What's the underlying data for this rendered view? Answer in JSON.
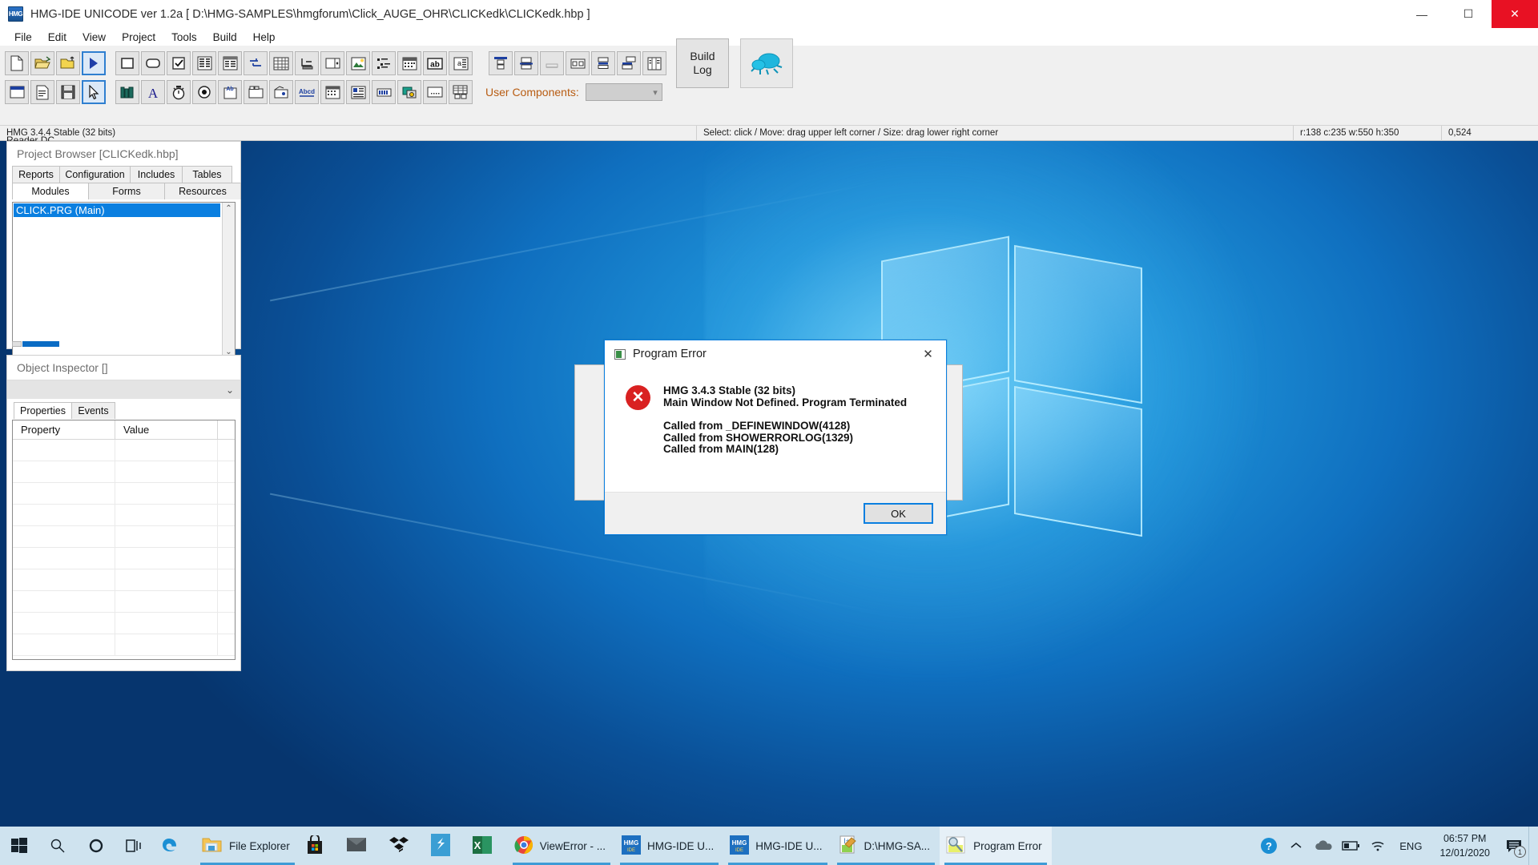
{
  "window": {
    "app_icon": "hmg-app-icon",
    "title": "HMG-IDE  UNICODE  ver 1.2a  [ D:\\HMG-SAMPLES\\hmgforum\\Click_AUGE_OHR\\CLICKedk\\CLICKedk.hbp ]",
    "minimize": "—",
    "maximize": "☐",
    "close": "✕"
  },
  "menu": {
    "items": [
      "File",
      "Edit",
      "View",
      "Project",
      "Tools",
      "Build",
      "Help"
    ]
  },
  "toolbar": {
    "row1": [
      {
        "name": "new-file-icon",
        "sel": false
      },
      {
        "name": "open-folder-icon",
        "sel": false
      },
      {
        "name": "save-folder-icon",
        "sel": false
      },
      {
        "name": "run-icon",
        "sel": true
      },
      {
        "name": "button-control-icon",
        "sel": false
      },
      {
        "name": "rounded-button-icon",
        "sel": false
      },
      {
        "name": "checkbox-control-icon",
        "sel": false
      },
      {
        "name": "listbox-control-icon",
        "sel": false
      },
      {
        "name": "grid-control-icon",
        "sel": false
      },
      {
        "name": "splitter-icon",
        "sel": false
      },
      {
        "name": "table-control-icon",
        "sel": false
      },
      {
        "name": "tree-control-icon",
        "sel": false
      },
      {
        "name": "spinner-control-icon",
        "sel": false
      },
      {
        "name": "image-control-icon",
        "sel": false
      },
      {
        "name": "treeview-icon",
        "sel": false
      },
      {
        "name": "month-calendar-icon",
        "sel": false
      },
      {
        "name": "label-ab-icon",
        "sel": false
      },
      {
        "name": "richtext-icon",
        "sel": false
      }
    ],
    "row1b": [
      {
        "name": "align-top-icon"
      },
      {
        "name": "align-middle-icon"
      },
      {
        "name": "align-bottom-icon"
      },
      {
        "name": "align-left-icon"
      },
      {
        "name": "align-center-icon"
      },
      {
        "name": "align-right-icon"
      },
      {
        "name": "distribute-icon"
      }
    ],
    "row2": [
      {
        "name": "window-icon",
        "sel": false
      },
      {
        "name": "document-icon",
        "sel": false
      },
      {
        "name": "save-disk-icon",
        "sel": false
      },
      {
        "name": "pointer-select-icon",
        "sel": true
      },
      {
        "name": "library-icon",
        "sel": false
      },
      {
        "name": "font-a-icon",
        "sel": false
      },
      {
        "name": "timer-icon",
        "sel": false
      },
      {
        "name": "radio-control-icon",
        "sel": false
      },
      {
        "name": "ab-frame-icon",
        "sel": false
      },
      {
        "name": "tab-control-icon",
        "sel": false
      },
      {
        "name": "player-control-icon",
        "sel": false
      },
      {
        "name": "abcd-link-icon",
        "sel": false
      },
      {
        "name": "date-picker-icon",
        "sel": false
      },
      {
        "name": "list-detail-icon",
        "sel": false
      },
      {
        "name": "progressbar-icon",
        "sel": false
      },
      {
        "name": "ole-control-icon",
        "sel": false
      },
      {
        "name": "panel-dotted-icon",
        "sel": false
      },
      {
        "name": "database-grid-icon",
        "sel": false
      }
    ],
    "user_components_label": "User Components:",
    "user_components_value": "",
    "build_log_line1": "Build",
    "build_log_line2": "Log",
    "debug_icon": "bug-icon"
  },
  "statusbar": {
    "version": "HMG 3.4.4 Stable (32 bits)",
    "hint": "Select: click / Move: drag upper left corner / Size: drag lower right corner",
    "geometry": "r:138 c:235 w:550 h:350",
    "coords": "0,524"
  },
  "desktop": {
    "peek_label": "Reader DC"
  },
  "browser": {
    "title": "Project Browser [CLICKedk.hbp]",
    "tabs_row1": [
      "Reports",
      "Configuration",
      "Includes",
      "Tables"
    ],
    "tabs_row2": [
      "Modules",
      "Forms",
      "Resources"
    ],
    "active_tab": "Modules",
    "items": [
      "CLICK.PRG (Main)"
    ],
    "scroll_up": "⌃",
    "scroll_down": "⌄"
  },
  "inspector": {
    "title": "Object Inspector []",
    "combo_value": "",
    "combo_caret": "⌄",
    "tabs": [
      "Properties",
      "Events"
    ],
    "active_tab": "Properties",
    "columns": [
      "Property",
      "Value",
      ""
    ],
    "rows": []
  },
  "dialog": {
    "icon": "program-window-icon",
    "title": "Program Error",
    "close": "✕",
    "error_icon": "error-cross-icon",
    "lines": [
      "HMG 3.4.3 Stable (32 bits)",
      "Main Window Not Defined. Program Terminated"
    ],
    "stack": [
      "Called from _DEFINEWINDOW(4128)",
      "Called from SHOWERRORLOG(1329)",
      "Called from MAIN(128)"
    ],
    "ok_label": "OK"
  },
  "taskbar": {
    "start": "windows-start-icon",
    "search": "search-icon",
    "cortana": "cortana-icon",
    "taskview": "task-view-icon",
    "pinned": [
      {
        "name": "edge-icon",
        "label": ""
      },
      {
        "name": "file-explorer-icon",
        "label": "File Explorer"
      },
      {
        "name": "microsoft-store-icon",
        "label": ""
      },
      {
        "name": "mail-icon",
        "label": ""
      },
      {
        "name": "dropbox-icon",
        "label": ""
      },
      {
        "name": "sublime-text-icon",
        "label": ""
      },
      {
        "name": "excel-icon",
        "label": ""
      }
    ],
    "tasks": [
      {
        "name": "chrome-icon",
        "label": "ViewError - ..."
      },
      {
        "name": "hmg-ide-icon",
        "label": "HMG-IDE  U..."
      },
      {
        "name": "hmg-ide-icon",
        "label": "HMG-IDE  U..."
      },
      {
        "name": "notepad-icon",
        "label": "D:\\HMG-SA..."
      },
      {
        "name": "program-error-icon",
        "label": "Program Error",
        "active": true
      }
    ],
    "tray": [
      {
        "name": "help-question-icon"
      },
      {
        "name": "show-hidden-icons-chevron"
      },
      {
        "name": "onedrive-cloud-icon"
      },
      {
        "name": "battery-icon"
      },
      {
        "name": "wifi-icon"
      }
    ],
    "language": "ENG",
    "time": "06:57 PM",
    "date": "12/01/2020",
    "notification_icon": "action-center-icon",
    "notification_count": "1"
  },
  "colors": {
    "accent": "#0a7fe0",
    "error_red": "#d92121",
    "close_red": "#e81123",
    "selection_blue": "#0a7fe0",
    "taskbar_bg": "#cfe3ef",
    "orange_label": "#b85c12"
  }
}
